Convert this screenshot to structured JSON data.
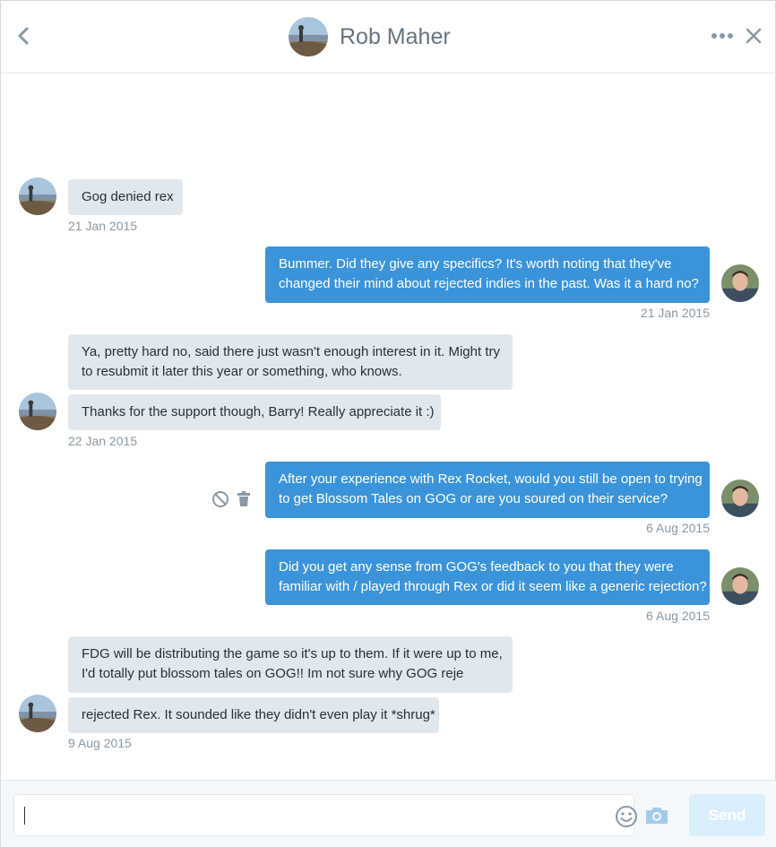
{
  "header": {
    "contact_name": "Rob Maher",
    "icons": [
      "back-chevron-icon",
      "more-dots-icon",
      "close-icon"
    ]
  },
  "messages": [
    {
      "from": "contact",
      "lines": [
        "Gog denied rex"
      ]
    },
    {
      "from": "contact",
      "timestamp": "21 Jan 2015"
    },
    {
      "from": "me",
      "lines": [
        "Bummer. Did they give any specifics? It's worth noting that they've",
        "changed their mind about rejected indies in the past. Was it a hard no?"
      ],
      "timestamp": "21 Jan 2015"
    },
    {
      "from": "contact",
      "lines": [
        "Ya, pretty hard no, said there just wasn't enough interest in it.  Might try",
        "to resubmit it later this year or something, who knows."
      ]
    },
    {
      "from": "contact",
      "lines": [
        "Thanks for the support though, Barry!  Really appreciate it :)"
      ],
      "timestamp": "22 Jan 2015"
    },
    {
      "from": "me",
      "lines": [
        "After your experience with Rex Rocket, would you still be open to trying",
        "to get Blossom Tales on GOG or are you soured on their service?"
      ],
      "timestamp": "6 Aug 2015"
    },
    {
      "from": "me",
      "lines": [
        "Did you get any sense from GOG's feedback to you that they were",
        "familiar with / played through Rex or did it seem like a generic rejection?"
      ],
      "timestamp": "6 Aug 2015"
    },
    {
      "from": "contact",
      "lines": [
        "FDG will be distributing the game so it's up to them.  If it were up to me,",
        "I'd totally put blossom tales on GOG!! Im not sure why GOG reje"
      ]
    },
    {
      "from": "contact",
      "lines": [
        "rejected Rex.  It sounded like they didn't even play it *shrug*"
      ],
      "timestamp": "9 Aug 2015"
    }
  ],
  "message_actions": {
    "icons": [
      "block-icon",
      "trash-icon"
    ]
  },
  "composer": {
    "value": "",
    "send_label": "Send",
    "icons": [
      "emoji-icon",
      "camera-icon"
    ]
  },
  "colors": {
    "incoming_bubble": "#e1e8ed",
    "outgoing_bubble": "#3b94d9",
    "send_disabled": "#dbeefc",
    "timestamp": "#8899a6"
  }
}
